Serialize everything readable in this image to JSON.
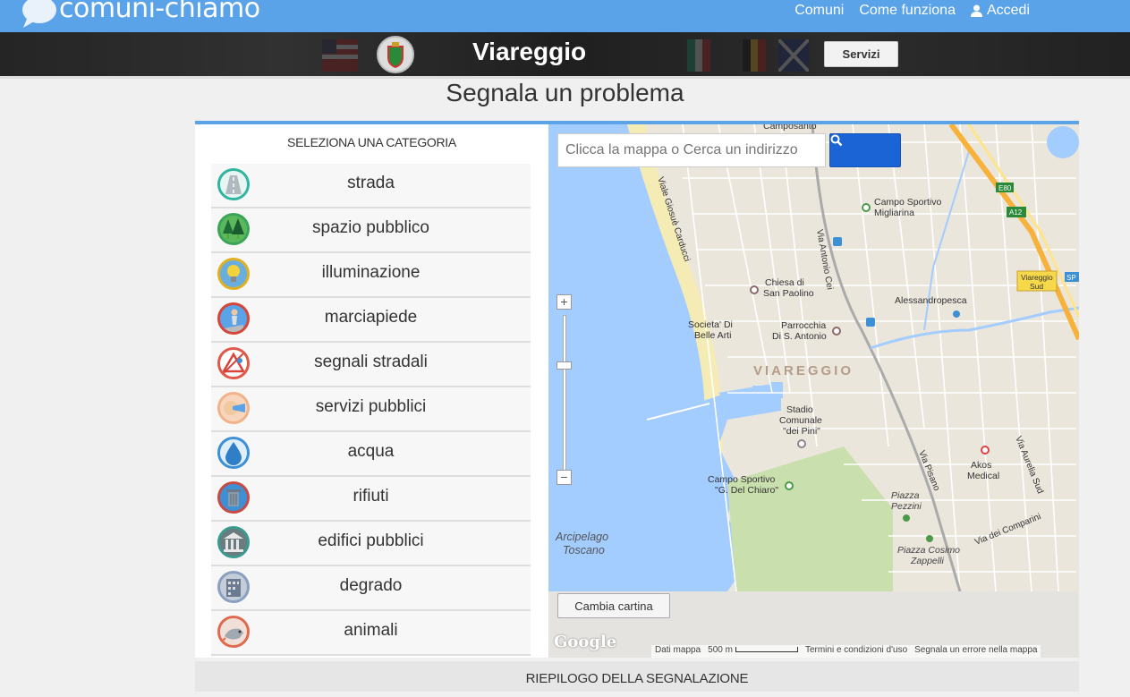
{
  "brand": {
    "name": "comuni-chiamo"
  },
  "nav": {
    "items": [
      "Comuni",
      "Come funziona"
    ],
    "login": "Accedi"
  },
  "city": {
    "name": "Viareggio",
    "services_button": "Servizi"
  },
  "page": {
    "title": "Segnala un problema"
  },
  "categories": {
    "header": "SELEZIONA UNA CATEGORIA",
    "items": [
      {
        "label": "strada",
        "icon": "road-icon",
        "color": "#2fb5a0"
      },
      {
        "label": "spazio pubblico",
        "icon": "trees-icon",
        "color": "#3aa55a"
      },
      {
        "label": "illuminazione",
        "icon": "lightbulb-icon",
        "color": "#e0b020"
      },
      {
        "label": "marciapiede",
        "icon": "pedestrian-icon",
        "color": "#d9443a"
      },
      {
        "label": "segnali stradali",
        "icon": "road-sign-icon",
        "color": "#e0584a"
      },
      {
        "label": "servizi pubblici",
        "icon": "public-service-icon",
        "color": "#f2b38a"
      },
      {
        "label": "acqua",
        "icon": "water-drop-icon",
        "color": "#3d8fd6"
      },
      {
        "label": "rifiuti",
        "icon": "trash-can-icon",
        "color": "#c84a44"
      },
      {
        "label": "edifici pubblici",
        "icon": "building-columns-icon",
        "color": "#3b9a8e"
      },
      {
        "label": "degrado",
        "icon": "derelict-building-icon",
        "color": "#8aa0c0"
      },
      {
        "label": "animali",
        "icon": "animal-icon",
        "color": "#e06a50"
      }
    ]
  },
  "map": {
    "search_placeholder": "Clicca la mappa o Cerca un indirizzo",
    "zoom_in": "+",
    "zoom_out": "−",
    "change_map_button": "Cambia cartina",
    "google": "Google",
    "footer": {
      "data": "Dati mappa",
      "scale": "500 m",
      "terms": "Termini e condizioni d'uso",
      "report": "Segnala un errore nella mappa"
    },
    "labels": {
      "city": "VIAREGGIO",
      "campo_sportivo_migliarina": [
        "Campo Sportivo",
        "Migliarina"
      ],
      "chiesa": [
        "Chiesa di",
        "San Paolino"
      ],
      "alessandropesca": "Alessandropesca",
      "societa": [
        "Societa' Di",
        "Belle Arti"
      ],
      "parrocchia": [
        "Parrocchia",
        "Di S. Antonio"
      ],
      "stadio": [
        "Stadio",
        "Comunale",
        "\"dei Pini\""
      ],
      "campo_sportivo_chiaro": [
        "Campo Sportivo",
        "\"G. Del Chiaro\""
      ],
      "akos": [
        "Akos",
        "Medical"
      ],
      "piazza_pezzini": [
        "Piazza",
        "Pezzini"
      ],
      "piazza_cosimo": [
        "Piazza Cosimo",
        "Zappelli"
      ],
      "arcipelago": [
        "Arcipelago",
        "Toscano"
      ],
      "viareggio_sud": [
        "Viareggio",
        "Sud"
      ],
      "road_carducci": "Viale Giosuè Carducci",
      "road_cei": "Via Antonio Cei",
      "road_pisano": "Via Pisano",
      "road_aurelia": "Via Aurelia Sud",
      "road_comparini": "Via dei Comparini",
      "campo_santo": "Camposanto",
      "e80": "E80",
      "a12": "A12",
      "sp": "SP"
    }
  },
  "summary": {
    "header": "RIEPILOGO DELLA SEGNALAZIONE"
  }
}
